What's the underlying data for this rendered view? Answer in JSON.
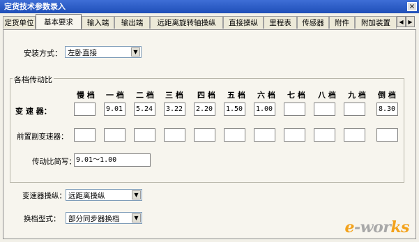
{
  "window": {
    "title": "定货技术参数录入",
    "close_glyph": "×"
  },
  "tabs": [
    "定货单位",
    "基本要求",
    "输入端",
    "输出端",
    "远距离旋转轴操纵",
    "直接操纵",
    "里程表",
    "传感器",
    "附件",
    "附加装置"
  ],
  "tabs_active_index": 1,
  "tab_scroll": {
    "left": "◀",
    "right": "▶"
  },
  "install": {
    "label": "安装方式：",
    "value": "左卧直接",
    "arrow": "▼"
  },
  "ratio_group": {
    "title": "各档传动比",
    "columns": [
      "慢 档",
      "一 档",
      "二 档",
      "三 档",
      "四 档",
      "五 档",
      "六 档",
      "七 档",
      "八 档",
      "九 档",
      "倒 档"
    ],
    "rows": [
      {
        "label": "变 速 器：",
        "values": [
          "",
          "9.01",
          "5.24",
          "3.22",
          "2.20",
          "1.50",
          "1.00",
          "",
          "",
          "",
          "8.30"
        ]
      },
      {
        "label": "前置副变速器：",
        "values": [
          "",
          "",
          "",
          "",
          "",
          "",
          "",
          "",
          "",
          "",
          ""
        ]
      }
    ],
    "summary_label": "传动比简写：",
    "summary_value": "9.01～1.00"
  },
  "gearbox_control": {
    "label": "变速器操纵：",
    "value": "远距离操纵",
    "arrow": "▼"
  },
  "shift_type": {
    "label": "换档型式：",
    "value": "部分同步器换档",
    "arrow": "▼"
  },
  "watermark": {
    "part1": "e",
    "part2": "-wor",
    "part3": "ks"
  }
}
